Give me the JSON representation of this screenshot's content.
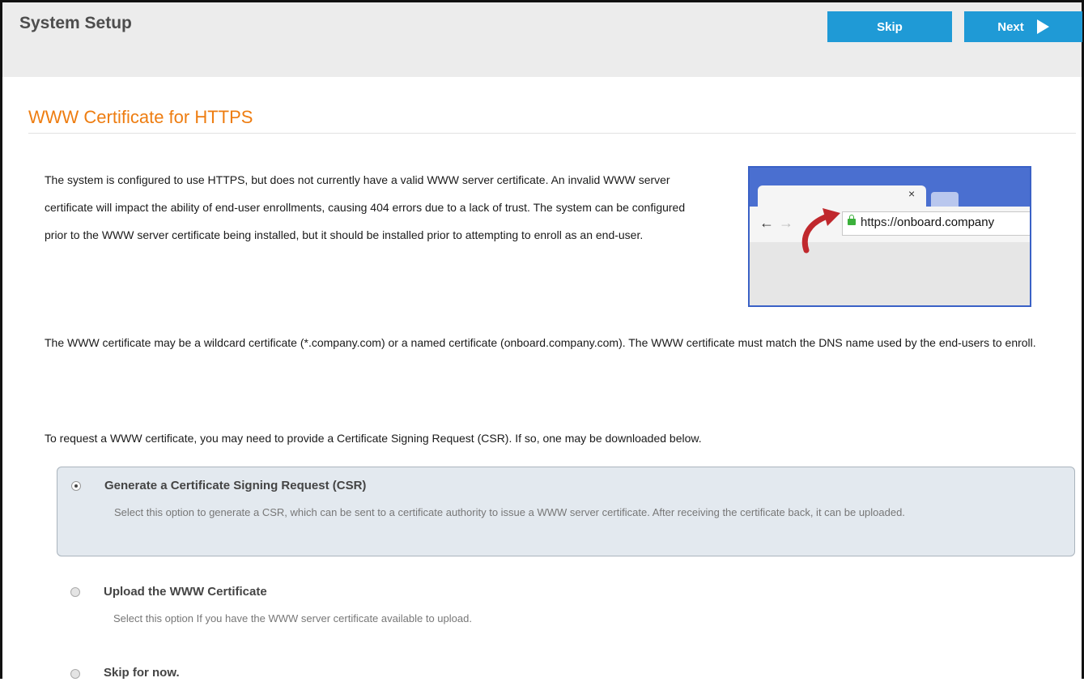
{
  "header": {
    "title": "System Setup",
    "skip_label": "Skip",
    "next_label": "Next"
  },
  "section": {
    "title": "WWW Certificate for HTTPS"
  },
  "paragraphs": {
    "intro": "The system is configured to use HTTPS, but does not currently have a valid WWW server certificate. An invalid WWW server certificate will impact the ability of end-user enrollments, causing 404 errors due to a lack of trust. The system can be configured prior to the WWW server certificate being installed, but it should be installed prior to attempting to enroll as an end-user.",
    "wildcard": "The WWW certificate may be a wildcard certificate (*.company.com) or a named certificate (onboard.company.com). The WWW certificate must match the DNS name used by the end-users to enroll.",
    "csr": "To request a WWW certificate, you may need to provide a Certificate Signing Request (CSR). If so, one may be downloaded below."
  },
  "illustration": {
    "tab_close": "×",
    "url_prefix": "https://",
    "url_host": "onboard.company"
  },
  "options": [
    {
      "title": "Generate a Certificate Signing Request (CSR)",
      "description": "Select this option to generate a CSR, which can be sent to a certificate authority to issue a WWW server certificate. After receiving the certificate back, it can be uploaded.",
      "selected": true
    },
    {
      "title": "Upload the WWW Certificate",
      "description": "Select this option If you have the WWW server certificate available to upload.",
      "selected": false
    },
    {
      "title": "Skip for now.",
      "selected": false
    }
  ],
  "colors": {
    "accent_blue": "#1f9ad6",
    "title_orange": "#ee7d11",
    "header_bg": "#ececec",
    "selected_bg": "#e3e9ef"
  }
}
